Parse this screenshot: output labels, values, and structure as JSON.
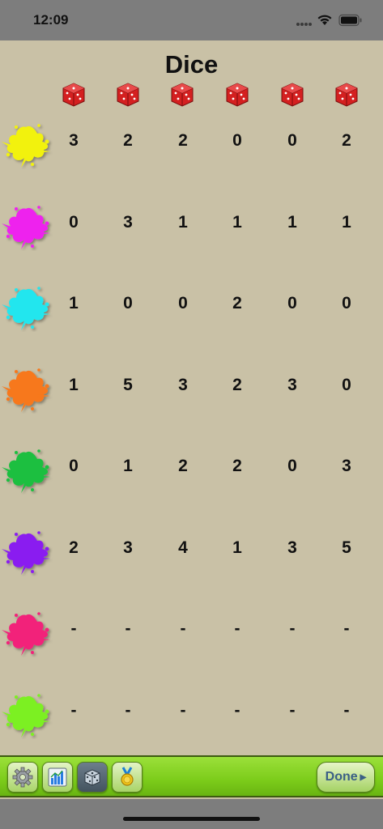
{
  "status_bar": {
    "time": "12:09"
  },
  "title": "Dice",
  "dice_header": [
    "die-icon",
    "die-icon",
    "die-icon",
    "die-icon",
    "die-icon",
    "die-icon"
  ],
  "players": [
    {
      "color_name": "yellow",
      "color": "#f2f20a",
      "scores": [
        "3",
        "2",
        "2",
        "0",
        "0",
        "2"
      ]
    },
    {
      "color_name": "magenta",
      "color": "#ee22ee",
      "scores": [
        "0",
        "3",
        "1",
        "1",
        "1",
        "1"
      ]
    },
    {
      "color_name": "cyan",
      "color": "#22e6ee",
      "scores": [
        "1",
        "0",
        "0",
        "2",
        "0",
        "0"
      ]
    },
    {
      "color_name": "orange",
      "color": "#f7781a",
      "scores": [
        "1",
        "5",
        "3",
        "2",
        "3",
        "0"
      ]
    },
    {
      "color_name": "green",
      "color": "#1fbf40",
      "scores": [
        "0",
        "1",
        "2",
        "2",
        "0",
        "3"
      ]
    },
    {
      "color_name": "purple",
      "color": "#8a1ff0",
      "scores": [
        "2",
        "3",
        "4",
        "1",
        "3",
        "5"
      ]
    },
    {
      "color_name": "pink",
      "color": "#f2207a",
      "scores": [
        "-",
        "-",
        "-",
        "-",
        "-",
        "-"
      ]
    },
    {
      "color_name": "lime",
      "color": "#7cf020",
      "scores": [
        "-",
        "-",
        "-",
        "-",
        "-",
        "-"
      ]
    }
  ],
  "toolbar": {
    "buttons": [
      "settings-icon",
      "chart-icon",
      "dice-icon",
      "medal-icon"
    ],
    "active_button": "dice-icon",
    "done_label": "Done"
  },
  "colors": {
    "background": "#c9c1a6",
    "toolbar_green": "#7ccc1a",
    "die_red": "#d42020",
    "done_text": "#3b5f86"
  }
}
